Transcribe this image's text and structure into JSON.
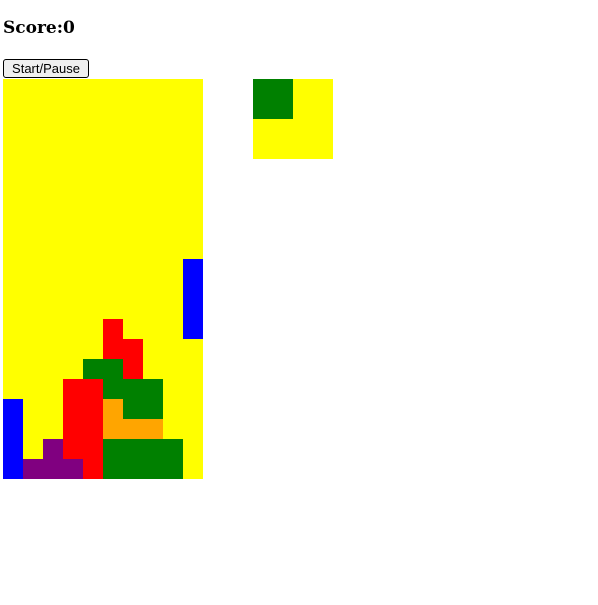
{
  "score": {
    "label": "Score:0"
  },
  "controls": {
    "start_pause_label": "Start/Pause"
  },
  "colors": {
    "empty": "#ffff00",
    "blue": "#0000ff",
    "red": "#ff0000",
    "green": "#008000",
    "orange": "#ffa500",
    "purple": "#800080"
  },
  "board": {
    "columns": 10,
    "rows": 20,
    "grid": [
      "..........",
      "..........",
      "..........",
      "..........",
      "..........",
      "..........",
      "..........",
      "..........",
      "..........",
      ".........B",
      ".........B",
      ".........B",
      ".....R...B",
      ".....RR...",
      "....GGR...",
      "...RRGGG..",
      "B..RROGG..",
      "B..RROOO..",
      "B.PRRGGGG.",
      "BPPPRGGGG."
    ]
  },
  "next_piece": {
    "columns": 2,
    "rows": 2,
    "grid": [
      "G.",
      ".."
    ]
  }
}
